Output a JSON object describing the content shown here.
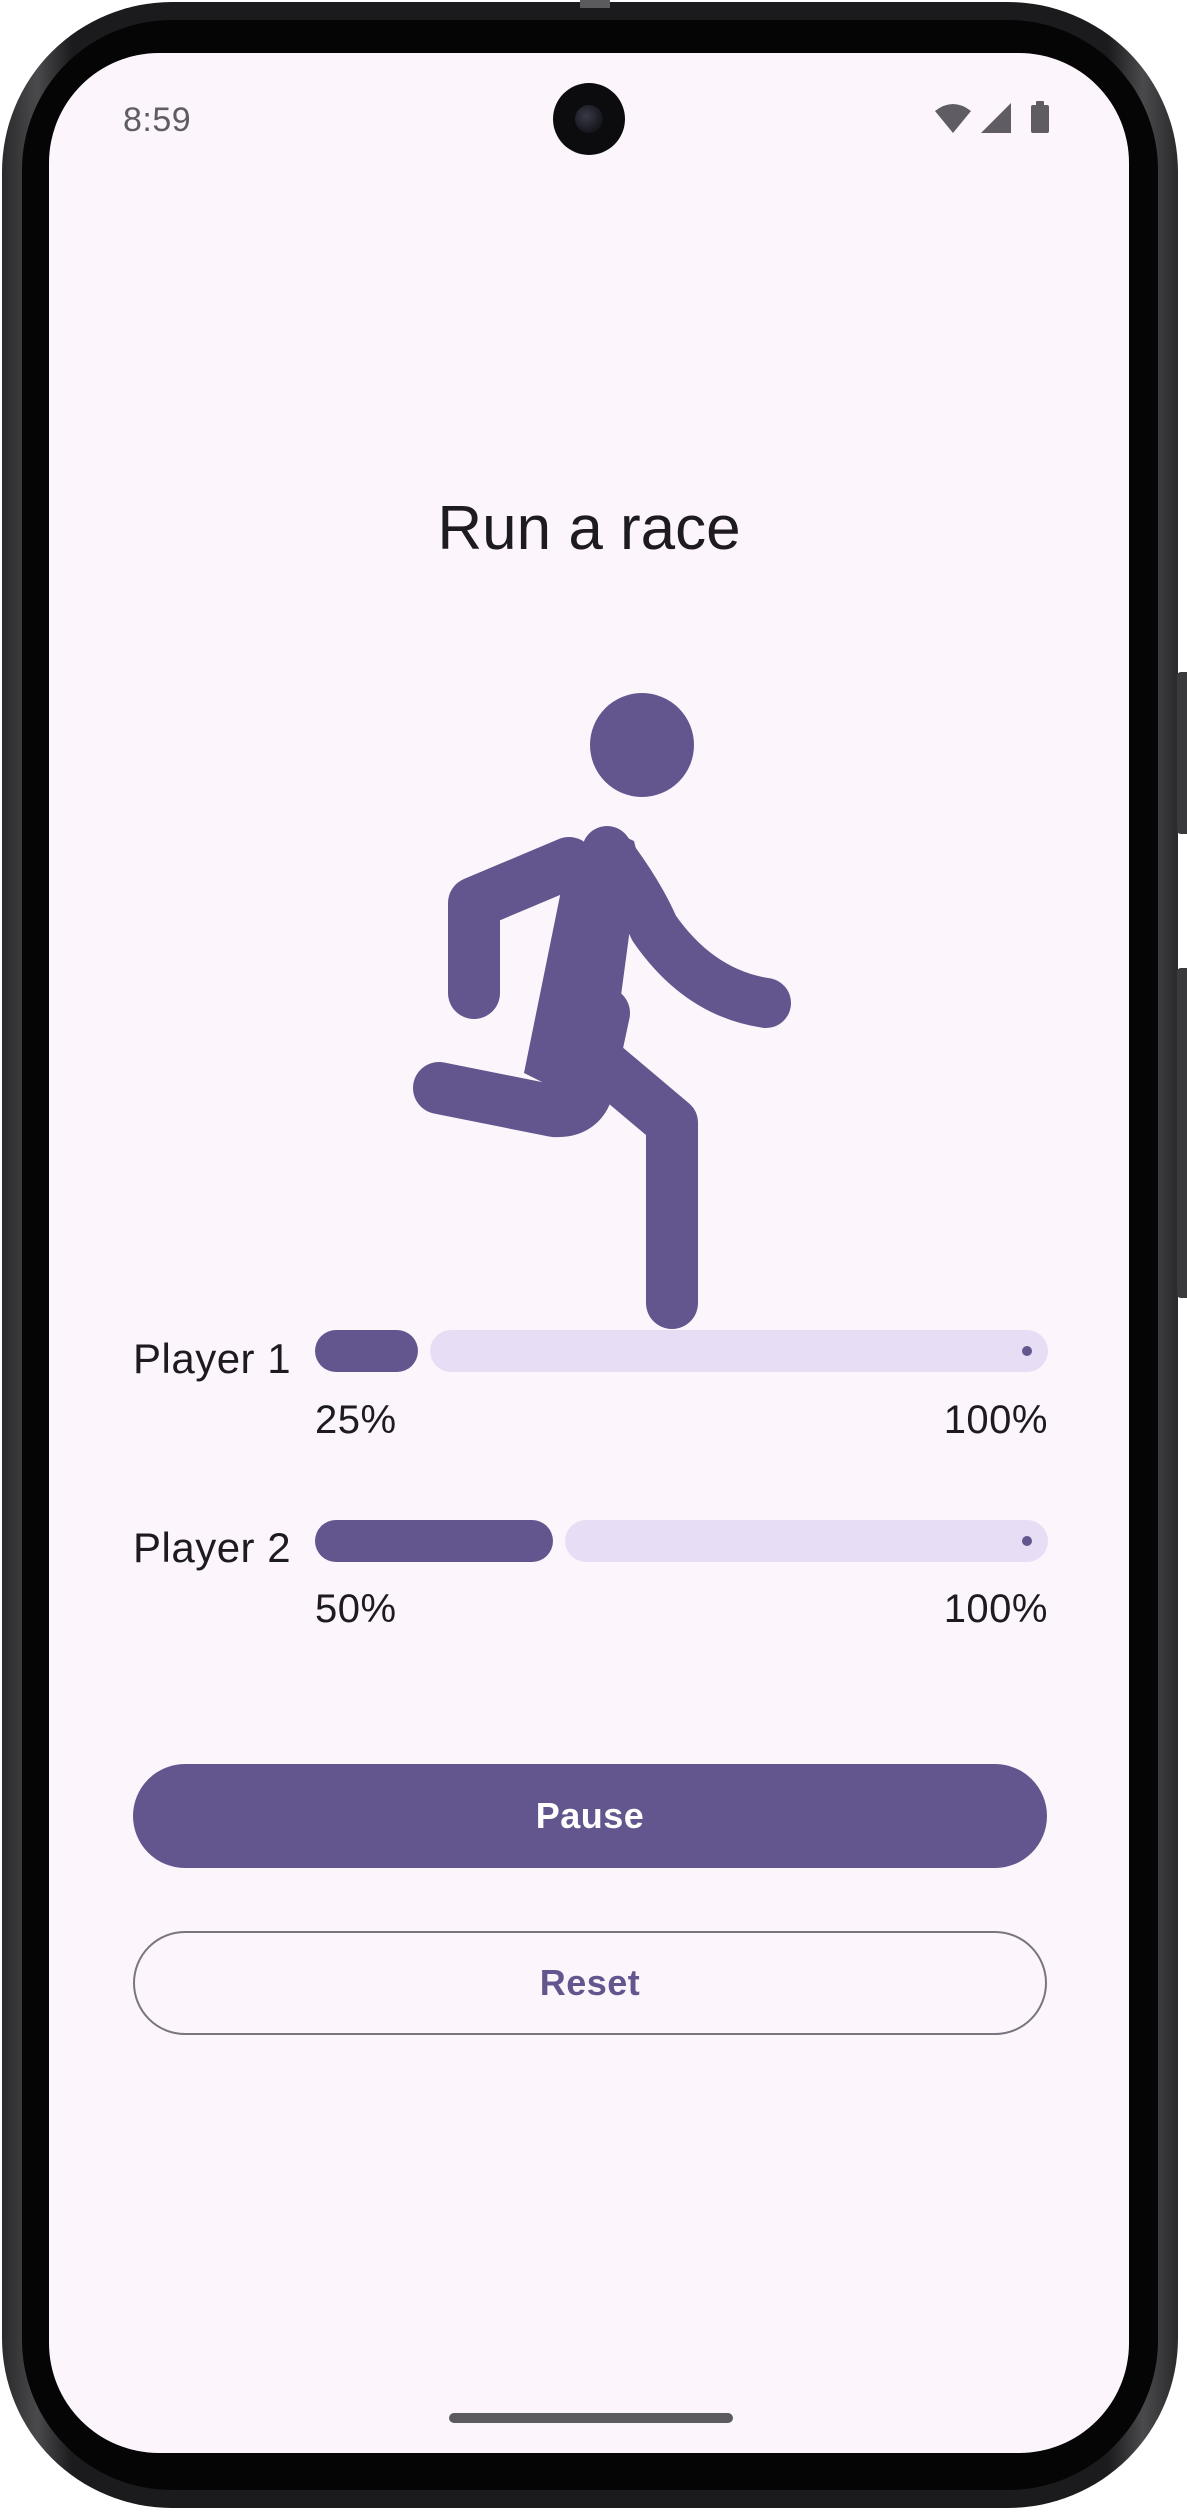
{
  "status_bar": {
    "time": "8:59",
    "icons": [
      "wifi-icon",
      "cellular-signal-icon",
      "battery-icon"
    ]
  },
  "screen": {
    "title": "Run a race",
    "illustration": "running-person-icon"
  },
  "players": [
    {
      "label": "Player 1",
      "progress_text": "25%",
      "max_text": "100%",
      "progress": 0.25
    },
    {
      "label": "Player 2",
      "progress_text": "50%",
      "max_text": "100%",
      "progress": 0.5
    }
  ],
  "buttons": {
    "pause_label": "Pause",
    "reset_label": "Reset"
  },
  "colors": {
    "primary": "#63568e",
    "track_inactive": "#e7def5",
    "background": "#fcf6fc",
    "text": "#1d1b20",
    "outline": "#79747e"
  }
}
